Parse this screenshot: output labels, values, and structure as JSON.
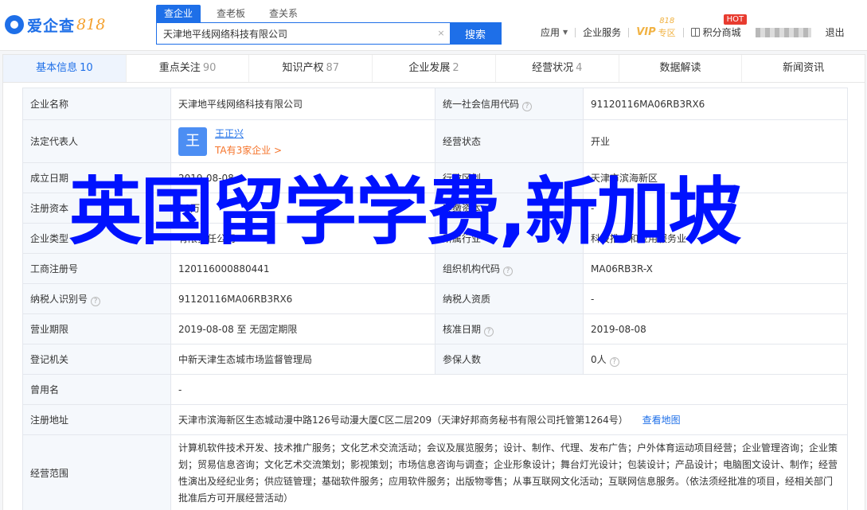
{
  "header": {
    "logo_text": "爱企查",
    "logo_num": "818",
    "search_tabs": [
      "查企业",
      "查老板",
      "查关系"
    ],
    "search_value": "天津地平线网络科技有限公司",
    "clear_icon": "×",
    "search_button": "搜索",
    "nav": {
      "apply": "应用",
      "enterprise_service": "企业服务",
      "vip": "VIP",
      "vip_sub": "专区",
      "badge_818": "818",
      "points_mall": "积分商城",
      "hot": "HOT",
      "logout": "退出"
    }
  },
  "modules": [
    {
      "label": "基本信息",
      "count": "10"
    },
    {
      "label": "重点关注",
      "count": "90"
    },
    {
      "label": "知识产权",
      "count": "87"
    },
    {
      "label": "企业发展",
      "count": "2"
    },
    {
      "label": "经营状况",
      "count": "4"
    },
    {
      "label": "数据解读",
      "count": ""
    },
    {
      "label": "新闻资讯",
      "count": ""
    }
  ],
  "info": {
    "company_name_label": "企业名称",
    "company_name": "天津地平线网络科技有限公司",
    "credit_code_label": "统一社会信用代码",
    "credit_code": "91120116MA06RB3RX6",
    "legal_rep_label": "法定代表人",
    "legal_rep_avatar": "王",
    "legal_rep_name": "王正兴",
    "legal_rep_sub": "TA有3家企业 >",
    "status_label": "经营状态",
    "status": "开业",
    "established_label": "成立日期",
    "established": "2019-08-08",
    "district_label": "行政区划",
    "district": "天津市滨海新区",
    "capital_label": "注册资本",
    "capital": "20万",
    "paid_capital_label": "实缴资本",
    "paid_capital": "-",
    "type_label": "企业类型",
    "type": "有限责任公司",
    "industry_label": "所属行业",
    "industry": "科技推广和应用服务业",
    "reg_no_label": "工商注册号",
    "reg_no": "120116000880441",
    "org_code_label": "组织机构代码",
    "org_code": "MA06RB3R-X",
    "tax_id_label": "纳税人识别号",
    "tax_id": "91120116MA06RB3RX6",
    "qualification_label": "纳税人资质",
    "qualification": "-",
    "term_label": "营业期限",
    "term": "2019-08-08 至 无固定期限",
    "approved_label": "核准日期",
    "approved": "2019-08-08",
    "authority_label": "登记机关",
    "authority": "中新天津生态城市场监督管理局",
    "insured_label": "参保人数",
    "insured": "0人",
    "former_name_label": "曾用名",
    "former_name": "-",
    "address_label": "注册地址",
    "address": "天津市滨海新区生态城动漫中路126号动漫大厦C区二层209（天津好邦商务秘书有限公司托管第1264号）",
    "map_link": "查看地图",
    "scope_label": "经营范围",
    "scope": "计算机软件技术开发、技术推广服务；文化艺术交流活动；会议及展览服务；设计、制作、代理、发布广告；户外体育运动项目经营；企业管理咨询；企业策划；贸易信息咨询；文化艺术交流策划；影视策划；市场信息咨询与调查；企业形象设计；舞台灯光设计；包装设计；产品设计；电脑图文设计、制作；经营性演出及经纪业务；供应链管理；基础软件服务；应用软件服务；出版物零售；从事互联网文化活动；互联网信息服务。（依法须经批准的项目，经相关部门批准后方可开展经营活动）"
  },
  "overlay_title": "英国留学学费,新加坡",
  "colors": {
    "brand": "#1e6fe8",
    "overlay": "#0012ff",
    "hot": "#e83b2f",
    "vip": "#f1b243"
  }
}
